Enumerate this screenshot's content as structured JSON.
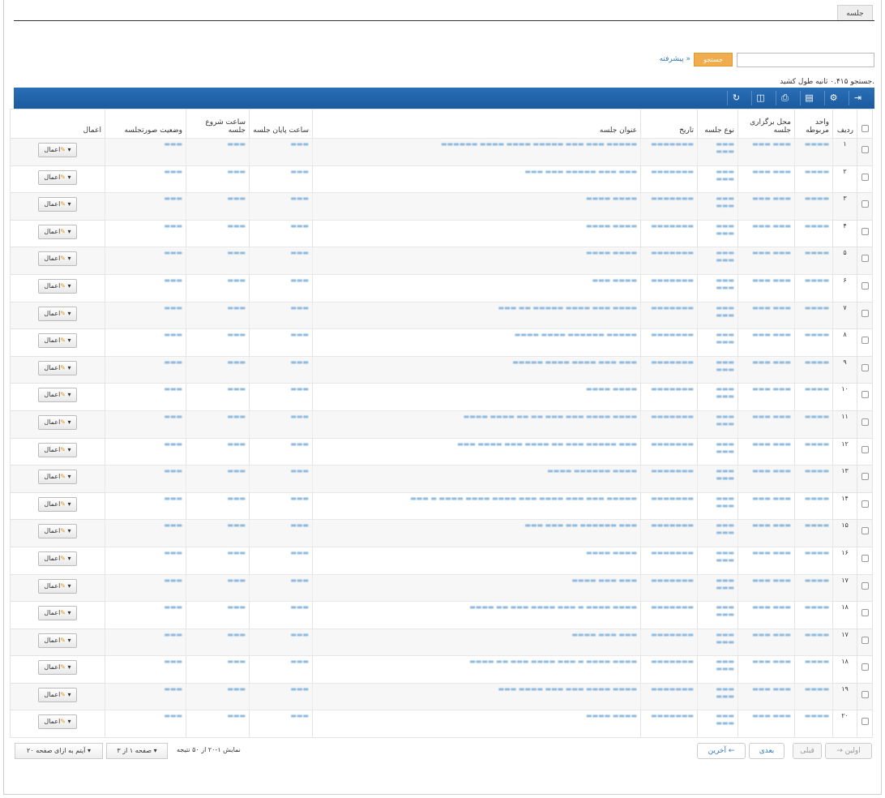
{
  "tab": {
    "label": "جلسه"
  },
  "search": {
    "placeholder": "",
    "button": "جستجو",
    "advanced": "پیشرفته »",
    "time_text": "جستجو ۰.۴۱۵ ثانیه طول کشید."
  },
  "toolbar": {
    "icons": [
      "export-icon",
      "gear-icon",
      "columns-icon",
      "print-icon",
      "chart-icon",
      "refresh-icon"
    ]
  },
  "table": {
    "headers": {
      "row": "ردیف",
      "unit": "واحد مربوطه",
      "place": "محل برگزاری جلسه",
      "type": "نوع جلسه",
      "date": "تاریخ",
      "title": "عنوان جلسه",
      "end": "ساعت پایان جلسه",
      "start": "ساعت شروع جلسه",
      "status": "وضعیت صورتجلسه",
      "actions": "اعمال"
    },
    "action_label": "اعمال",
    "rows": [
      {
        "n": "۱",
        "title": "▬▬▬▬▬ ▬▬▬ ▬▬▬ ▬▬▬▬▬ ▬▬▬▬ ▬▬▬▬ ▬▬▬▬▬▬"
      },
      {
        "n": "۲",
        "title": "▬▬▬ ▬▬▬ ▬▬▬▬▬ ▬▬▬ ▬▬▬"
      },
      {
        "n": "۳",
        "title": "▬▬▬▬ ▬▬▬▬"
      },
      {
        "n": "۴",
        "title": "▬▬▬▬ ▬▬▬▬"
      },
      {
        "n": "۵",
        "title": "▬▬▬▬ ▬▬▬▬"
      },
      {
        "n": "۶",
        "title": "▬▬▬▬ ▬▬▬"
      },
      {
        "n": "۷",
        "title": "▬▬▬▬ ▬▬▬ ▬▬▬▬ ▬▬▬▬▬ ▬▬ ▬▬▬"
      },
      {
        "n": "۸",
        "title": "▬▬▬▬▬ ▬▬▬▬▬▬ ▬▬▬▬ ▬▬▬▬"
      },
      {
        "n": "۹",
        "title": "▬▬▬ ▬▬▬ ▬▬▬▬ ▬▬▬▬ ▬▬▬▬▬"
      },
      {
        "n": "۱۰",
        "title": "▬▬▬▬ ▬▬▬▬"
      },
      {
        "n": "۱۱",
        "title": "▬▬▬▬ ▬▬▬▬ ▬▬▬ ▬▬▬ ▬▬ ▬▬ ▬▬▬▬ ▬▬▬▬"
      },
      {
        "n": "۱۲",
        "title": "▬▬▬ ▬▬▬▬▬ ▬▬▬ ▬▬ ▬▬▬▬ ▬▬▬ ▬▬▬▬ ▬▬▬"
      },
      {
        "n": "۱۳",
        "title": "▬▬▬▬ ▬▬▬▬▬▬ ▬▬▬▬"
      },
      {
        "n": "۱۴",
        "title": "▬▬▬▬▬ ▬▬▬ ▬▬▬ ▬▬▬▬ ▬▬▬ ▬▬▬▬ ▬▬▬▬ ▬▬▬▬ ▬ ▬▬▬"
      },
      {
        "n": "۱۵",
        "title": "▬▬▬ ▬▬▬▬▬▬ ▬▬ ▬▬▬ ▬▬▬"
      },
      {
        "n": "۱۶",
        "title": "▬▬▬▬ ▬▬▬▬"
      },
      {
        "n": "۱۷",
        "title": "▬▬▬ ▬▬▬ ▬▬▬▬"
      },
      {
        "n": "۱۸",
        "title": "▬▬▬▬ ▬▬▬▬ ▬ ▬▬▬ ▬▬▬▬ ▬▬▬ ▬▬ ▬▬▬▬"
      },
      {
        "n": "۱۷",
        "title": "▬▬▬ ▬▬▬ ▬▬▬▬"
      },
      {
        "n": "۱۸",
        "title": "▬▬▬▬ ▬▬▬▬ ▬ ▬▬▬ ▬▬▬▬ ▬▬▬ ▬▬ ▬▬▬▬"
      },
      {
        "n": "۱۹",
        "title": "▬▬▬▬ ▬▬▬▬ ▬▬▬ ▬▬▬ ▬▬▬▬ ▬▬▬"
      },
      {
        "n": "۲۰",
        "title": "▬▬▬▬ ▬▬▬▬"
      }
    ],
    "blurred": {
      "unit": "▬▬▬▬",
      "place": "▬▬▬ ▬▬▬",
      "type": "▬▬▬ ▬▬▬",
      "date": "▬▬▬▬▬▬▬",
      "end": "▬▬▬",
      "start": "▬▬▬",
      "status": "▬▬▬"
    }
  },
  "pager": {
    "first": "→ اولین",
    "prev": "قبلی",
    "next": "بعدی",
    "last": "آخرین ←",
    "info": "نمایش ۱-۲۰ از ۵۰ نتیجه",
    "page_select": "صفحه ۱ از ۳",
    "per_page": "۲۰ آیتم به ازای صفحه"
  }
}
